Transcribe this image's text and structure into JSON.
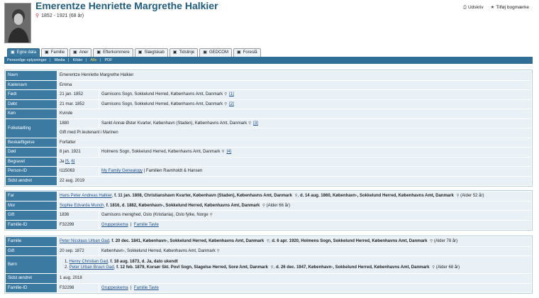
{
  "header": {
    "title": "Emerentze Henriette Margrethe Halkier",
    "dates": "1852 - 1921  (68 år)",
    "print_label": "Udskriv",
    "bookmark_label": "Tilføj bogmærke"
  },
  "tabs": [
    {
      "label": "Egne data",
      "icon": "person-icon"
    },
    {
      "label": "Familie",
      "icon": "family-icon"
    },
    {
      "label": "Aner",
      "icon": "tree-icon"
    },
    {
      "label": "Efterkommere",
      "icon": "descendants-icon"
    },
    {
      "label": "Slægtskab",
      "icon": "relation-icon"
    },
    {
      "label": "Tidslinje",
      "icon": "timeline-icon"
    },
    {
      "label": "GEDCOM",
      "icon": "gedcom-icon"
    },
    {
      "label": "Foreslå",
      "icon": "suggest-icon"
    }
  ],
  "subnav": {
    "items": [
      "Personlige oplysninger",
      "Media",
      "Kilder",
      "Alle",
      "PDF"
    ],
    "active": "Alle"
  },
  "person": {
    "navn_k": "Navn",
    "navn": "Emerentze Henriette Margrethe Halkier",
    "kaele_k": "Kælenavn",
    "kaele": "Emma",
    "fodt_k": "Født",
    "fodt_d": "21 jan. 1852",
    "fodt_p": "Garnisons Sogn, Sokkelund Herred, Københavns Amt, Danmark",
    "fodt_s": "[1]",
    "dobt_k": "Døbt",
    "dobt_d": "21 mar. 1852",
    "dobt_p": "Garnisons Sogn, Sokkelund Herred, Københavns Amt, Danmark",
    "dobt_s": "[2]",
    "kon_k": "Køn",
    "kon": "Kvinde",
    "folk_k": "Folketælling",
    "folk_d": "1880",
    "folk_p": "Sankt Annæ Øster Kvarter, København (Staden), Københavns Amt, Danmark",
    "folk_s": "[3]",
    "folk_note": "Gift med Pr.leutenant i Marinen",
    "besk_k": "Beskæftigelse",
    "besk": "Forfatter",
    "dod_k": "Død",
    "dod_d": "8 jan. 1921",
    "dod_p": "Holmens Sogn, Sokkelund Herred, Københavns Amt, Danmark",
    "dod_s": "[4]",
    "beg_k": "Begravet",
    "beg_pre": "Ja ",
    "beg_s1": "[5,",
    "beg_s2": "6]",
    "pid_k": "Person-ID",
    "pid": "I115063",
    "pid_tree": "My Family Genealogy",
    "pid_rest": " | Familien Ravnholdt & Hansen",
    "sidst_k": "Sidst ændret",
    "sidst": "22 aug. 2019"
  },
  "parents": {
    "far_k": "Far",
    "far_name": "Hans Peter Andreas Halkier",
    "far_info": " f. 11 jan. 1808, Christianshavn Kvarter, København (Staden), Københavns Amt, Danmark ",
    "far_info2": " d. 14 aug. 1860, København-, Sokkelund Herred, Københavns Amt, Danmark ",
    "far_age": " (Alder 52 år)",
    "mor_k": "Mor",
    "mor_name": "Sophie Edvarda Munch",
    "mor_info": " f. 1816, ",
    "mor_info2": " d. 1882, København-, Sokkelund Herred, Københavns Amt, Danmark ",
    "mor_age": " (Alder 66 år)",
    "gift_k": "Gift",
    "gift_d": "1836",
    "gift_p": "Garnisons menighed, Oslo (Kristiania), Oslo fylke, Norge",
    "fid_k": "Familie-ID",
    "fid": "F32299",
    "fid_l1": "Gruppeskema",
    "fid_l2": "Familie Tavle"
  },
  "family": {
    "fam_k": "Familie",
    "fam_name": "Peter Nicolaus Urban Gad",
    "fam_info": " f. 20 dec. 1841, København-, Sokkelund Herred, Københavns Amt, Danmark ",
    "fam_info2": " d. 6 apr. 1920, Holmens Sogn, Sokkelund Herred, Københavns Amt, Danmark ",
    "fam_age": " (Alder 78 år)",
    "gift_k": "Gift",
    "gift_d": "20 sep. 1872",
    "gift_p": "København-, Sokkelund Herred, Københavns Amt, Danmark",
    "born_k": "Børn",
    "child1_num": "1. ",
    "child1_name": "Henry Christian Gad",
    "child1_info": " f. 18 aug. 1873, ",
    "child1_info2": " d. Ja, dato ukendt",
    "child2_num": "2. ",
    "child2_name": "Peter Urban Bruun Gad",
    "child2_info": " f. 12 feb. 1879, Korsør Skt. Povl Sogn, Slagelse Herred, Sorø Amt, Danmark ",
    "child2_info2": " d. 26 dec. 1947, København-, Sokkelund Herred, Københavns Amt, Danmark ",
    "child2_age": " (Alder 68 år)",
    "sidst_k": "Sidst ændret",
    "sidst": "1 aug. 2018",
    "fid_k": "Familie-ID",
    "fid": "F32298",
    "fid_l1": "Gruppeskema",
    "fid_l2": "Familie Tavle"
  }
}
